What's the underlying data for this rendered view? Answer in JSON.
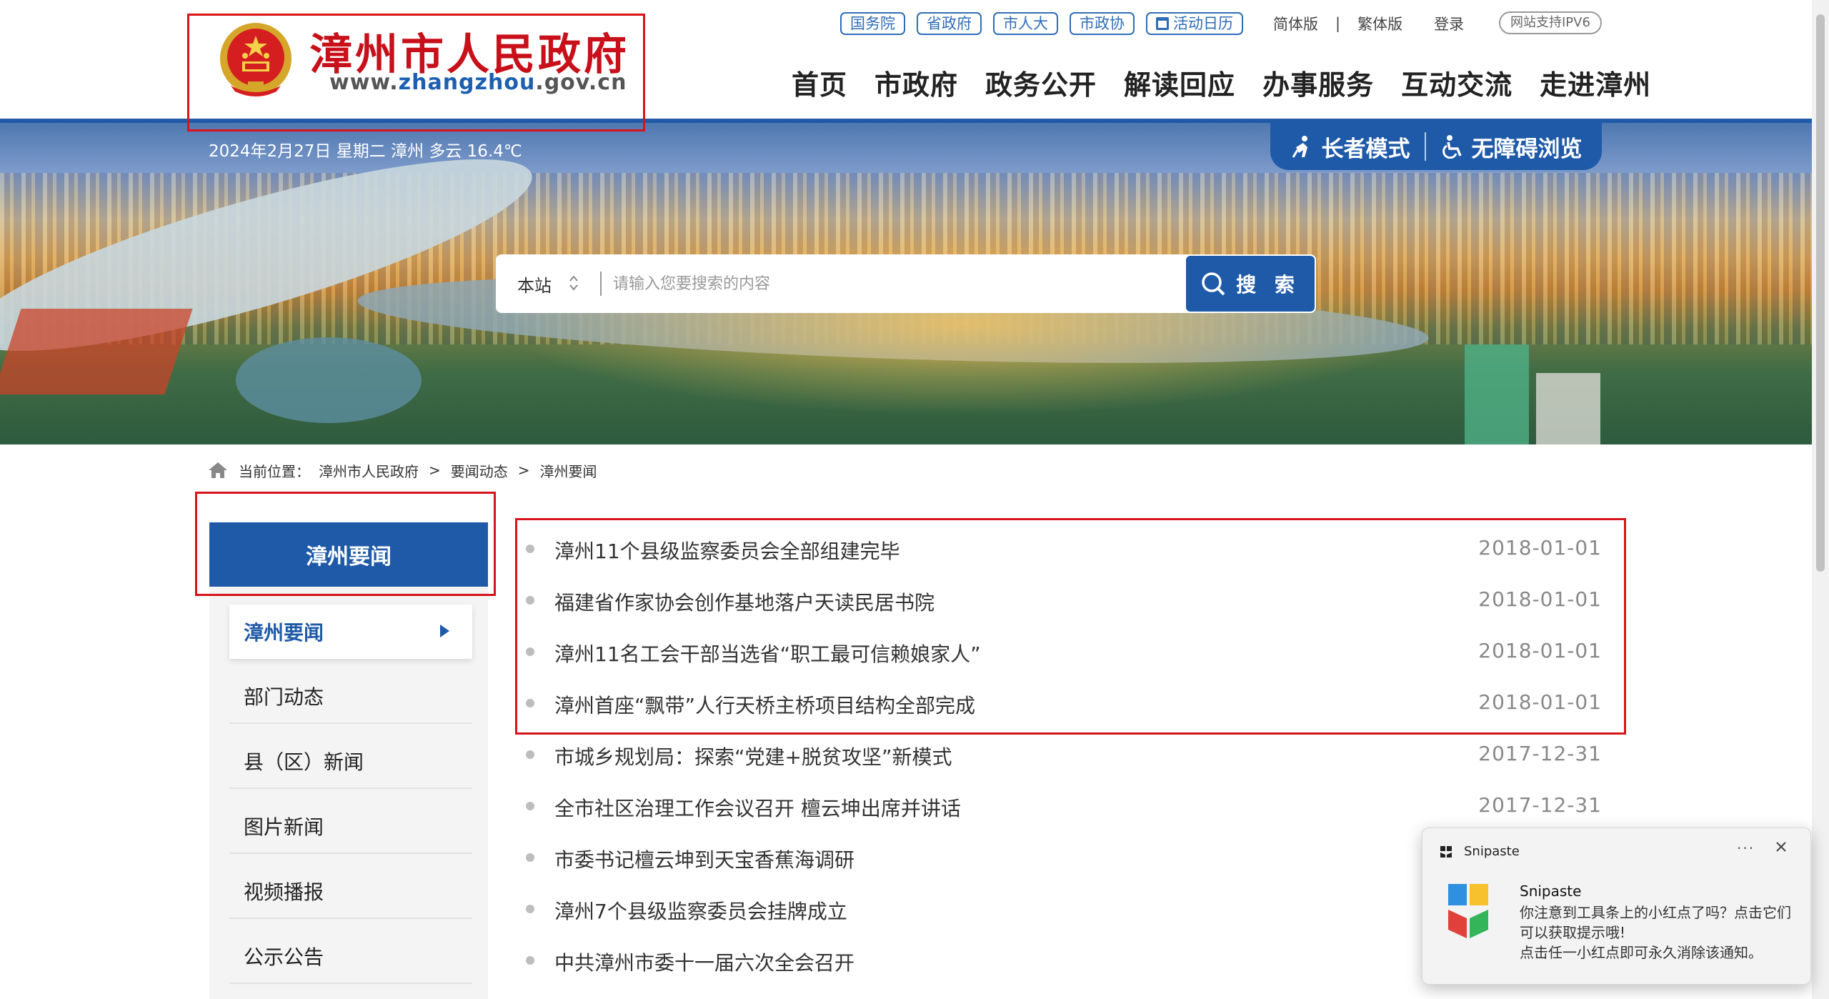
{
  "header": {
    "site_title": "漳州市人民政府",
    "site_url_prefix": "www.",
    "site_url_highlight": "zhangzhou",
    "site_url_suffix": ".gov.cn",
    "top_links": {
      "guowuyuan": "国务院",
      "shengzhengfu": "省政府",
      "shirenda": "市人大",
      "shizhengxie": "市政协",
      "calendar": "活动日历"
    },
    "simplified": "简体版",
    "separator": "|",
    "traditional": "繁体版",
    "login": "登录",
    "ipv6": "网站支持IPV6",
    "nav": [
      "首页",
      "市政府",
      "政务公开",
      "解读回应",
      "办事服务",
      "互动交流",
      "走进漳州"
    ]
  },
  "banner": {
    "date_weather": "2024年2月27日 星期二 漳州 多云 16.4℃",
    "elder_mode": "长者模式",
    "accessible": "无障碍浏览",
    "search_scope": "本站",
    "search_placeholder": "请输入您要搜索的内容",
    "search_button": "搜 索"
  },
  "breadcrumb": {
    "label": "当前位置：",
    "items": [
      "漳州市人民政府",
      "要闻动态",
      "漳州要闻"
    ],
    "arrow": ">"
  },
  "sidebar": {
    "title": "漳州要闻",
    "items": [
      {
        "label": "漳州要闻",
        "active": true
      },
      {
        "label": "部门动态",
        "active": false
      },
      {
        "label": "县（区）新闻",
        "active": false
      },
      {
        "label": "图片新闻",
        "active": false
      },
      {
        "label": "视频播报",
        "active": false
      },
      {
        "label": "公示公告",
        "active": false
      }
    ]
  },
  "news": [
    {
      "title": "漳州11个县级监察委员会全部组建完毕",
      "date": "2018-01-01"
    },
    {
      "title": "福建省作家协会创作基地落户天读民居书院",
      "date": "2018-01-01"
    },
    {
      "title": "漳州11名工会干部当选省“职工最可信赖娘家人”",
      "date": "2018-01-01"
    },
    {
      "title": "漳州首座“飘带”人行天桥主桥项目结构全部完成",
      "date": "2018-01-01"
    },
    {
      "title": "市城乡规划局：探索“党建+脱贫攻坚”新模式",
      "date": "2017-12-31"
    },
    {
      "title": "全市社区治理工作会议召开 檀云坤出席并讲话",
      "date": "2017-12-31"
    },
    {
      "title": "市委书记檀云坤到天宝香蕉海调研",
      "date": ""
    },
    {
      "title": "漳州7个县级监察委员会挂牌成立",
      "date": ""
    },
    {
      "title": "中共漳州市委十一届六次全会召开",
      "date": ""
    }
  ],
  "toast": {
    "app": "Snipaste",
    "more": "···",
    "name": "Snipaste",
    "message": "你注意到工具条上的小红点了吗？点击它们可以获取提示哦!\n点击任一小红点即可永久消除该通知。"
  },
  "colors": {
    "brand_blue": "#1f5aa8",
    "title_red": "#c8101a",
    "highlight_red": "#d7141b"
  }
}
